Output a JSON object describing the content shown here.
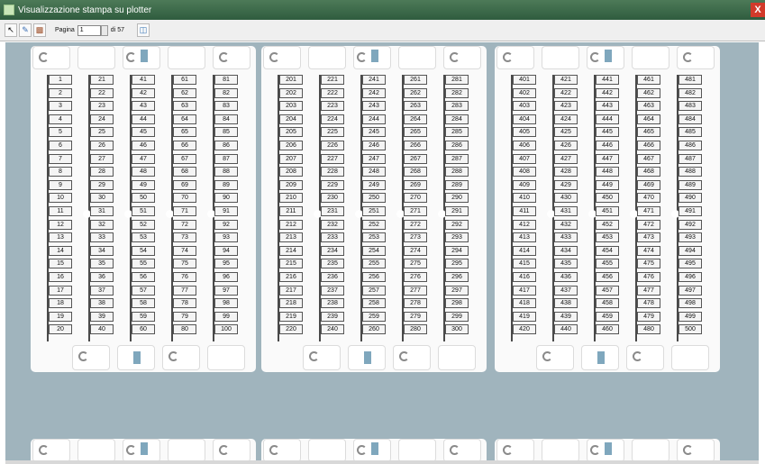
{
  "window": {
    "title": "Visualizzazione stampa su plotter",
    "close_label": "X"
  },
  "toolbar": {
    "icons": [
      "select-icon",
      "pen-icon",
      "printer-icon",
      "exit-door-icon"
    ],
    "page_label": "Pagina",
    "page_value": "1",
    "page_total": "di 57"
  },
  "sheet": {
    "groups": [
      {
        "columns": [
          [
            "1",
            "2",
            "3",
            "4",
            "5",
            "6",
            "7",
            "8",
            "9",
            "10",
            "11",
            "12",
            "13",
            "14",
            "15",
            "16",
            "17",
            "18",
            "19",
            "20"
          ],
          [
            "21",
            "22",
            "23",
            "24",
            "25",
            "26",
            "27",
            "28",
            "29",
            "30",
            "31",
            "32",
            "33",
            "34",
            "35",
            "36",
            "37",
            "38",
            "39",
            "40"
          ],
          [
            "41",
            "42",
            "43",
            "44",
            "45",
            "46",
            "47",
            "48",
            "49",
            "50",
            "51",
            "52",
            "53",
            "54",
            "55",
            "56",
            "57",
            "58",
            "59",
            "60"
          ],
          [
            "61",
            "62",
            "63",
            "64",
            "65",
            "66",
            "67",
            "68",
            "69",
            "70",
            "71",
            "72",
            "73",
            "74",
            "75",
            "76",
            "77",
            "78",
            "79",
            "80"
          ],
          [
            "81",
            "82",
            "83",
            "84",
            "85",
            "86",
            "87",
            "88",
            "89",
            "90",
            "91",
            "92",
            "93",
            "94",
            "95",
            "96",
            "97",
            "98",
            "99",
            "100"
          ]
        ]
      },
      {
        "columns": [
          [
            "201",
            "202",
            "203",
            "204",
            "205",
            "206",
            "207",
            "208",
            "209",
            "210",
            "211",
            "212",
            "213",
            "214",
            "215",
            "216",
            "217",
            "218",
            "219",
            "220"
          ],
          [
            "221",
            "222",
            "223",
            "224",
            "225",
            "226",
            "227",
            "228",
            "229",
            "230",
            "231",
            "232",
            "233",
            "234",
            "235",
            "236",
            "237",
            "238",
            "239",
            "240"
          ],
          [
            "241",
            "242",
            "243",
            "244",
            "245",
            "246",
            "247",
            "248",
            "249",
            "250",
            "251",
            "252",
            "253",
            "254",
            "255",
            "256",
            "257",
            "258",
            "259",
            "260"
          ],
          [
            "261",
            "262",
            "263",
            "264",
            "265",
            "266",
            "267",
            "268",
            "269",
            "270",
            "271",
            "272",
            "273",
            "274",
            "275",
            "276",
            "277",
            "278",
            "279",
            "280"
          ],
          [
            "281",
            "282",
            "283",
            "284",
            "285",
            "286",
            "287",
            "288",
            "289",
            "290",
            "291",
            "292",
            "293",
            "294",
            "295",
            "296",
            "297",
            "298",
            "299",
            "300"
          ]
        ]
      },
      {
        "columns": [
          [
            "401",
            "402",
            "403",
            "404",
            "405",
            "406",
            "407",
            "408",
            "409",
            "410",
            "411",
            "412",
            "413",
            "414",
            "415",
            "416",
            "417",
            "418",
            "419",
            "420"
          ],
          [
            "421",
            "422",
            "423",
            "424",
            "425",
            "426",
            "427",
            "428",
            "429",
            "430",
            "431",
            "432",
            "433",
            "434",
            "435",
            "436",
            "437",
            "438",
            "439",
            "440"
          ],
          [
            "441",
            "442",
            "443",
            "444",
            "445",
            "446",
            "447",
            "448",
            "449",
            "450",
            "451",
            "452",
            "453",
            "454",
            "455",
            "456",
            "457",
            "458",
            "459",
            "460"
          ],
          [
            "461",
            "462",
            "463",
            "464",
            "465",
            "466",
            "467",
            "468",
            "469",
            "470",
            "471",
            "472",
            "473",
            "474",
            "475",
            "476",
            "477",
            "478",
            "479",
            "480"
          ],
          [
            "481",
            "482",
            "483",
            "484",
            "485",
            "486",
            "487",
            "488",
            "489",
            "490",
            "491",
            "492",
            "493",
            "494",
            "495",
            "496",
            "497",
            "498",
            "499",
            "500"
          ]
        ]
      }
    ]
  }
}
